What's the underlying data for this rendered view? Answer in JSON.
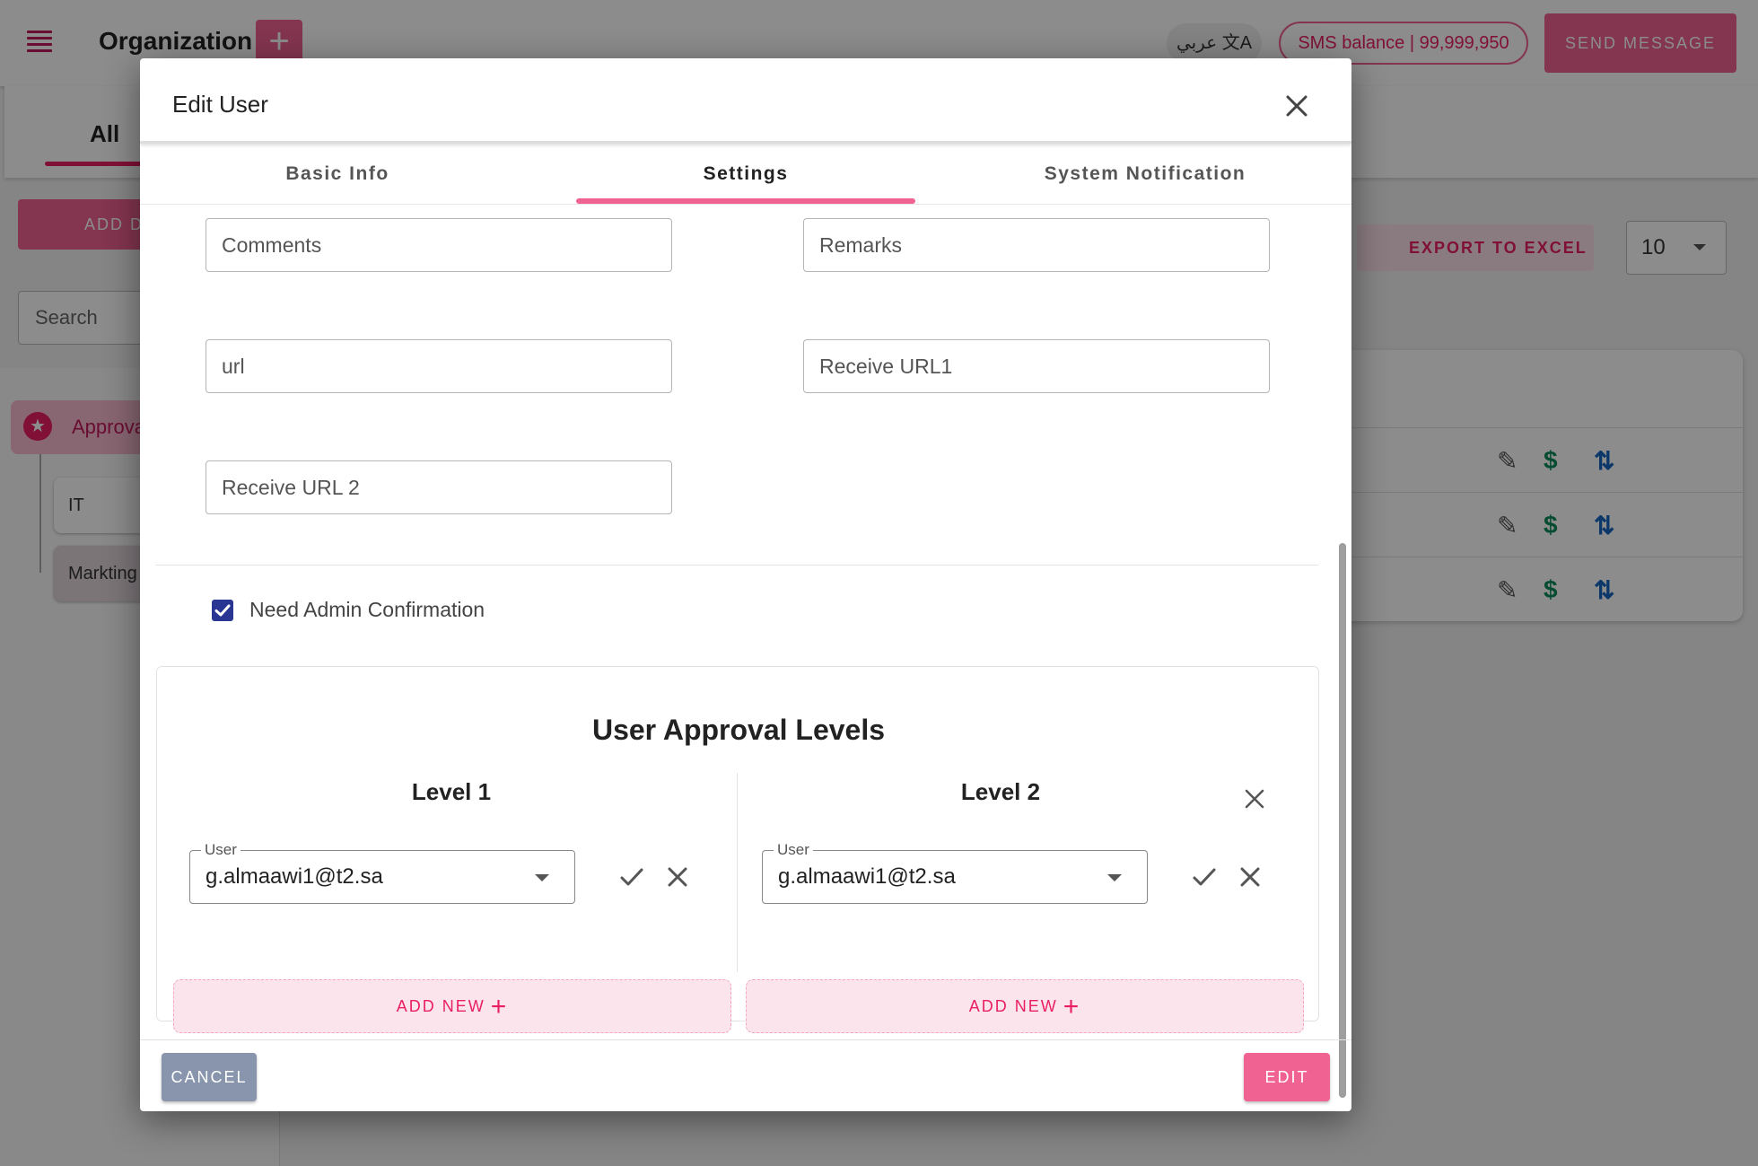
{
  "header": {
    "title": "Organization",
    "lang_label": "عربي",
    "sms_balance": "SMS balance | 99,999,950",
    "send_message": "SEND MESSAGE"
  },
  "background": {
    "tab_all": "All",
    "add_dept_label": "ADD D",
    "search_placeholder": "Search",
    "tree_root": "Approva",
    "tree_items": [
      "IT",
      "Markting"
    ],
    "export_label": "EXPORT TO EXCEL",
    "page_size": "10"
  },
  "dialog": {
    "title": "Edit User",
    "tabs": [
      "Basic Info",
      "Settings",
      "System Notification"
    ],
    "active_tab": "Settings",
    "fields": {
      "comments": "Comments",
      "remarks": "Remarks",
      "url": "url",
      "receive_url1": "Receive URL1",
      "receive_url2": "Receive URL 2"
    },
    "need_admin_confirmation": {
      "label": "Need Admin Confirmation",
      "checked": true
    },
    "approval": {
      "title": "User Approval Levels",
      "levels": [
        {
          "title": "Level 1",
          "user_label": "User",
          "user_value": "g.almaawi1@t2.sa",
          "add_new": "ADD NEW"
        },
        {
          "title": "Level 2",
          "user_label": "User",
          "user_value": "g.almaawi1@t2.sa",
          "add_new": "ADD NEW"
        }
      ]
    },
    "cancel_label": "CANCEL",
    "edit_label": "EDIT"
  },
  "colors": {
    "accent": "#f06292",
    "checkbox": "#283593",
    "cancel": "#8895ad"
  }
}
